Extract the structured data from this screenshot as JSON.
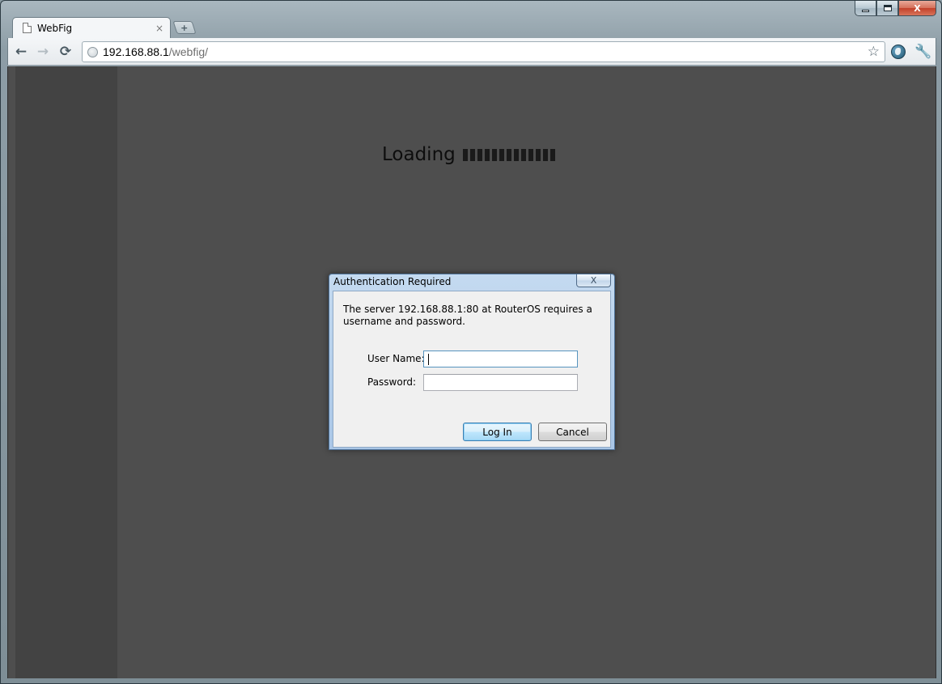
{
  "window": {
    "tab_title": "WebFig",
    "tab_close": "×",
    "new_tab": "+",
    "minimize": "",
    "maximize": "",
    "close": "X"
  },
  "toolbar": {
    "url_host": "192.168.88.1",
    "url_path": "/webfig/",
    "back": "←",
    "forward": "→",
    "reload": "⟳",
    "star": "☆",
    "wrench": "🔧"
  },
  "page": {
    "loading_text": "Loading",
    "loading_bar_count": 13
  },
  "dialog": {
    "title": "Authentication Required",
    "close": "X",
    "message": "The server 192.168.88.1:80 at RouterOS requires a username and password.",
    "username_label": "User Name:",
    "username_value": "",
    "password_label": "Password:",
    "password_value": "",
    "login_button": "Log In",
    "cancel_button": "Cancel"
  },
  "icons": {
    "tab": "page-icon",
    "omnibox": "globe-icon",
    "star": "star-icon",
    "extension": "earth-icon",
    "menu": "wrench-icon"
  },
  "colors": {
    "page_background": "#4e4e4e",
    "sidebar": "#434343",
    "dialog_frame": "#a9c6e6"
  }
}
